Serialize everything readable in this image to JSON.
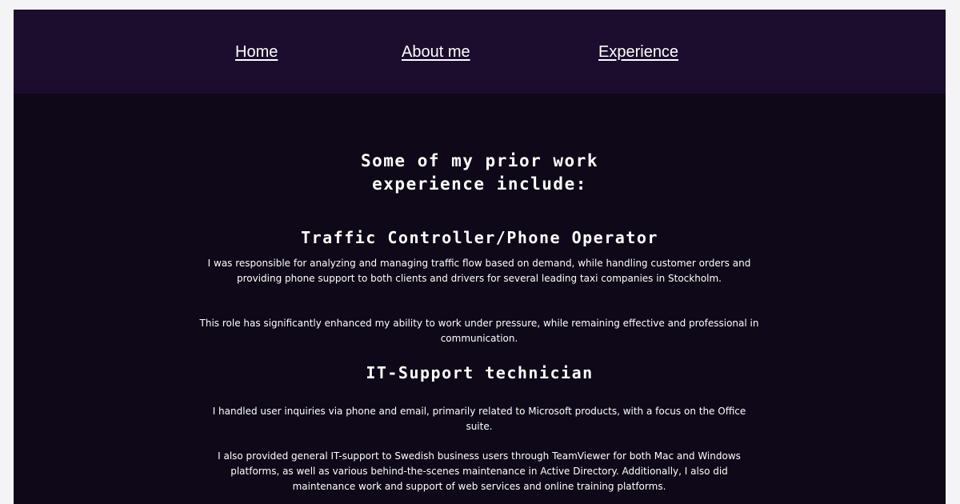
{
  "nav": {
    "home": "Home",
    "about": "About me",
    "experience": "Experience"
  },
  "intro": {
    "line1": "Some of my prior work",
    "line2": "experience include:"
  },
  "jobs": [
    {
      "title": "Traffic Controller/Phone Operator",
      "paragraphs": [
        "I was responsible for analyzing and managing traffic flow based on demand, while handling customer orders and providing phone support to both clients and drivers for several leading taxi companies in Stockholm.",
        "This role has significantly enhanced my ability to work under pressure, while remaining effective and professional in communication."
      ]
    },
    {
      "title": "IT-Support technician",
      "paragraphs": [
        "I handled user inquiries via phone and email, primarily related to Microsoft products, with a focus on the Office suite.",
        "I also provided general IT-support to Swedish business users through TeamViewer for both Mac and Windows platforms, as well as various behind-the-scenes maintenance in Active Directory. Additionally, I also did maintenance work and support of web services and online training platforms."
      ]
    }
  ],
  "colors": {
    "background": "#0e0818",
    "navbar": "#1c0d2e",
    "text": "#ffffff"
  }
}
